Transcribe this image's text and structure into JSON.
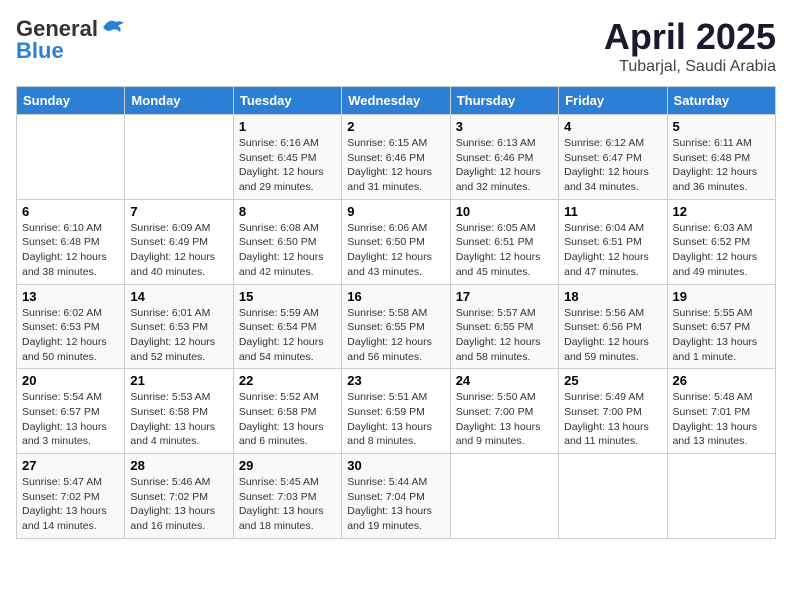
{
  "logo": {
    "part1": "General",
    "part2": "Blue"
  },
  "title": "April 2025",
  "location": "Tubarjal, Saudi Arabia",
  "days_of_week": [
    "Sunday",
    "Monday",
    "Tuesday",
    "Wednesday",
    "Thursday",
    "Friday",
    "Saturday"
  ],
  "weeks": [
    [
      {
        "day": "",
        "info": ""
      },
      {
        "day": "",
        "info": ""
      },
      {
        "day": "1",
        "info": "Sunrise: 6:16 AM\nSunset: 6:45 PM\nDaylight: 12 hours\nand 29 minutes."
      },
      {
        "day": "2",
        "info": "Sunrise: 6:15 AM\nSunset: 6:46 PM\nDaylight: 12 hours\nand 31 minutes."
      },
      {
        "day": "3",
        "info": "Sunrise: 6:13 AM\nSunset: 6:46 PM\nDaylight: 12 hours\nand 32 minutes."
      },
      {
        "day": "4",
        "info": "Sunrise: 6:12 AM\nSunset: 6:47 PM\nDaylight: 12 hours\nand 34 minutes."
      },
      {
        "day": "5",
        "info": "Sunrise: 6:11 AM\nSunset: 6:48 PM\nDaylight: 12 hours\nand 36 minutes."
      }
    ],
    [
      {
        "day": "6",
        "info": "Sunrise: 6:10 AM\nSunset: 6:48 PM\nDaylight: 12 hours\nand 38 minutes."
      },
      {
        "day": "7",
        "info": "Sunrise: 6:09 AM\nSunset: 6:49 PM\nDaylight: 12 hours\nand 40 minutes."
      },
      {
        "day": "8",
        "info": "Sunrise: 6:08 AM\nSunset: 6:50 PM\nDaylight: 12 hours\nand 42 minutes."
      },
      {
        "day": "9",
        "info": "Sunrise: 6:06 AM\nSunset: 6:50 PM\nDaylight: 12 hours\nand 43 minutes."
      },
      {
        "day": "10",
        "info": "Sunrise: 6:05 AM\nSunset: 6:51 PM\nDaylight: 12 hours\nand 45 minutes."
      },
      {
        "day": "11",
        "info": "Sunrise: 6:04 AM\nSunset: 6:51 PM\nDaylight: 12 hours\nand 47 minutes."
      },
      {
        "day": "12",
        "info": "Sunrise: 6:03 AM\nSunset: 6:52 PM\nDaylight: 12 hours\nand 49 minutes."
      }
    ],
    [
      {
        "day": "13",
        "info": "Sunrise: 6:02 AM\nSunset: 6:53 PM\nDaylight: 12 hours\nand 50 minutes."
      },
      {
        "day": "14",
        "info": "Sunrise: 6:01 AM\nSunset: 6:53 PM\nDaylight: 12 hours\nand 52 minutes."
      },
      {
        "day": "15",
        "info": "Sunrise: 5:59 AM\nSunset: 6:54 PM\nDaylight: 12 hours\nand 54 minutes."
      },
      {
        "day": "16",
        "info": "Sunrise: 5:58 AM\nSunset: 6:55 PM\nDaylight: 12 hours\nand 56 minutes."
      },
      {
        "day": "17",
        "info": "Sunrise: 5:57 AM\nSunset: 6:55 PM\nDaylight: 12 hours\nand 58 minutes."
      },
      {
        "day": "18",
        "info": "Sunrise: 5:56 AM\nSunset: 6:56 PM\nDaylight: 12 hours\nand 59 minutes."
      },
      {
        "day": "19",
        "info": "Sunrise: 5:55 AM\nSunset: 6:57 PM\nDaylight: 13 hours\nand 1 minute."
      }
    ],
    [
      {
        "day": "20",
        "info": "Sunrise: 5:54 AM\nSunset: 6:57 PM\nDaylight: 13 hours\nand 3 minutes."
      },
      {
        "day": "21",
        "info": "Sunrise: 5:53 AM\nSunset: 6:58 PM\nDaylight: 13 hours\nand 4 minutes."
      },
      {
        "day": "22",
        "info": "Sunrise: 5:52 AM\nSunset: 6:58 PM\nDaylight: 13 hours\nand 6 minutes."
      },
      {
        "day": "23",
        "info": "Sunrise: 5:51 AM\nSunset: 6:59 PM\nDaylight: 13 hours\nand 8 minutes."
      },
      {
        "day": "24",
        "info": "Sunrise: 5:50 AM\nSunset: 7:00 PM\nDaylight: 13 hours\nand 9 minutes."
      },
      {
        "day": "25",
        "info": "Sunrise: 5:49 AM\nSunset: 7:00 PM\nDaylight: 13 hours\nand 11 minutes."
      },
      {
        "day": "26",
        "info": "Sunrise: 5:48 AM\nSunset: 7:01 PM\nDaylight: 13 hours\nand 13 minutes."
      }
    ],
    [
      {
        "day": "27",
        "info": "Sunrise: 5:47 AM\nSunset: 7:02 PM\nDaylight: 13 hours\nand 14 minutes."
      },
      {
        "day": "28",
        "info": "Sunrise: 5:46 AM\nSunset: 7:02 PM\nDaylight: 13 hours\nand 16 minutes."
      },
      {
        "day": "29",
        "info": "Sunrise: 5:45 AM\nSunset: 7:03 PM\nDaylight: 13 hours\nand 18 minutes."
      },
      {
        "day": "30",
        "info": "Sunrise: 5:44 AM\nSunset: 7:04 PM\nDaylight: 13 hours\nand 19 minutes."
      },
      {
        "day": "",
        "info": ""
      },
      {
        "day": "",
        "info": ""
      },
      {
        "day": "",
        "info": ""
      }
    ]
  ]
}
